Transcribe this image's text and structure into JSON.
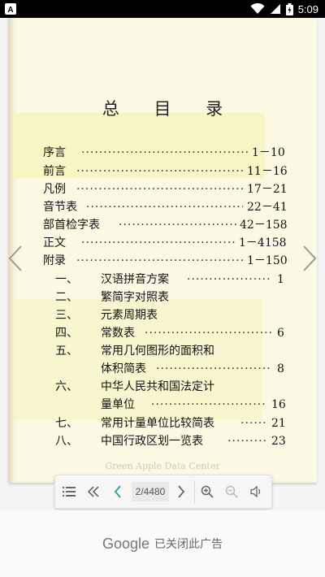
{
  "status_bar": {
    "time": "5:09",
    "left_badge": "A"
  },
  "book": {
    "title": "总 目 录",
    "watermark": "Green Apple Data Center",
    "toc": [
      {
        "label": "序言",
        "pages": "1－10"
      },
      {
        "label": "前言",
        "pages": "11－16"
      },
      {
        "label": "凡例",
        "pages": "17－21"
      },
      {
        "label": "音节表",
        "pages": "22－41"
      },
      {
        "label": "部首检字表",
        "pages": "42－158"
      },
      {
        "label": "正文",
        "pages": "1－4158"
      },
      {
        "label": "附录",
        "pages": "1－150"
      }
    ],
    "appendix": [
      {
        "num": "一、",
        "label": "汉语拼音方案",
        "pages": "1"
      },
      {
        "num": "二、",
        "label": "繁简字对照表",
        "pages": ""
      },
      {
        "num": "三、",
        "label": "元素周期表",
        "pages": ""
      },
      {
        "num": "四、",
        "label": "常数表",
        "pages": "6"
      },
      {
        "num": "五、",
        "label": "常用几何图形的面积和",
        "label2": "体积简表",
        "pages": "8"
      },
      {
        "num": "六、",
        "label": "中华人民共和国法定计",
        "label2": "量单位",
        "pages": "16"
      },
      {
        "num": "七、",
        "label": "常用计量单位比较简表",
        "pages": "21"
      },
      {
        "num": "八、",
        "label": "中国行政区划一览表",
        "pages": "23"
      }
    ]
  },
  "toolbar": {
    "page_indicator": "2/4480"
  },
  "ad": {
    "brand": "Google",
    "text": "已关闭此广告"
  }
}
